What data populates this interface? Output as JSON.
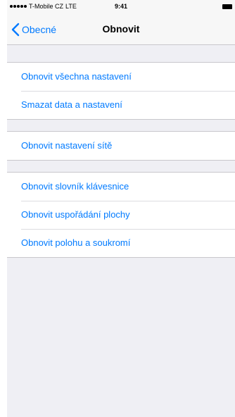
{
  "status_bar": {
    "carrier": "T-Mobile CZ",
    "network": "LTE",
    "time": "9:41"
  },
  "nav": {
    "back_label": "Obecné",
    "title": "Obnovit"
  },
  "groups": [
    {
      "items": [
        {
          "label": "Obnovit všechna nastavení"
        },
        {
          "label": "Smazat data a nastavení"
        }
      ]
    },
    {
      "items": [
        {
          "label": "Obnovit nastavení sítě"
        }
      ]
    },
    {
      "items": [
        {
          "label": "Obnovit slovník klávesnice"
        },
        {
          "label": "Obnovit uspořádání plochy"
        },
        {
          "label": "Obnovit polohu a soukromí"
        }
      ]
    }
  ],
  "colors": {
    "accent": "#007aff",
    "background": "#efeff4",
    "separator": "#c8c7cc"
  },
  "icons": {
    "back": "chevron-left-icon",
    "signal": "signal-dots-icon",
    "battery": "battery-icon"
  }
}
